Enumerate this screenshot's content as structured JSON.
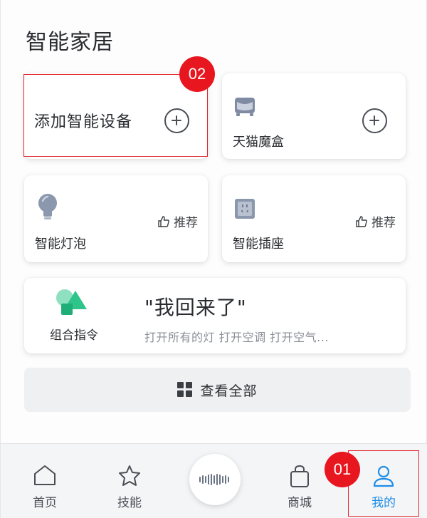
{
  "section": {
    "title": "智能家居"
  },
  "cards": {
    "add": {
      "label": "添加智能设备",
      "icon": "plus-circle-icon"
    },
    "tmall": {
      "name": "天猫魔盒",
      "icon": "tmall-box-icon"
    },
    "bulb": {
      "name": "智能灯泡",
      "recommend": "推荐",
      "icon": "bulb-icon"
    },
    "socket": {
      "name": "智能插座",
      "recommend": "推荐",
      "icon": "socket-icon"
    },
    "combo": {
      "label": "组合指令",
      "title": "\"我回来了\"",
      "subtitle": "打开所有的灯 打开空调 打开空气...",
      "icon": "combo-shapes-icon"
    }
  },
  "view_all": {
    "label": "查看全部",
    "icon": "grid-icon"
  },
  "tabbar": {
    "items": [
      {
        "label": "首页",
        "icon": "home-icon",
        "active": false
      },
      {
        "label": "技能",
        "icon": "star-icon",
        "active": false
      },
      {
        "label": "商城",
        "icon": "bag-icon",
        "active": false
      },
      {
        "label": "我的",
        "icon": "user-icon",
        "active": true
      }
    ],
    "voice_icon": "voice-wave-icon"
  },
  "annotations": {
    "badge_1": "01",
    "badge_2": "02"
  },
  "colors": {
    "accent": "#1f8de6",
    "badge": "#e8161f",
    "highlight": "#e0242b",
    "combo_green": "#2fc48a",
    "icon_gray": "#8a97ad"
  }
}
